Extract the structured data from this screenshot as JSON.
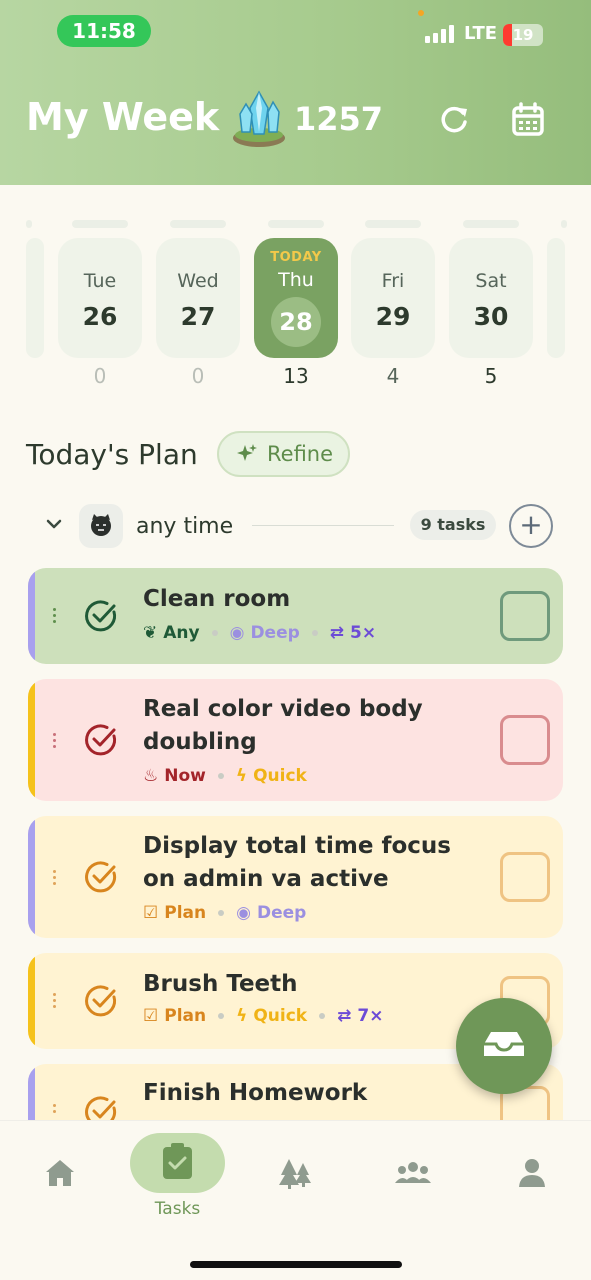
{
  "status_bar": {
    "time": "11:58",
    "network": "LTE",
    "battery": "19"
  },
  "header": {
    "title": "My Week",
    "points": "1257"
  },
  "week": {
    "days": [
      {
        "name": "Tue",
        "date": "26",
        "count": "0"
      },
      {
        "name": "Wed",
        "date": "27",
        "count": "0"
      },
      {
        "name": "Thu",
        "date": "28",
        "count": "13",
        "today_label": "TODAY"
      },
      {
        "name": "Fri",
        "date": "29",
        "count": "4"
      },
      {
        "name": "Sat",
        "date": "30",
        "count": "5"
      }
    ]
  },
  "plan": {
    "title": "Today's Plan",
    "refine_label": "Refine"
  },
  "group": {
    "name": "any time",
    "task_count": "9 tasks",
    "add": "+"
  },
  "tasks": [
    {
      "title": "Clean room",
      "tags": [
        "Any",
        "Deep",
        "5×"
      ]
    },
    {
      "title": "Real color video body doubling",
      "tags": [
        "Now",
        "Quick"
      ]
    },
    {
      "title": "Display total time focus on admin va active",
      "tags": [
        "Plan",
        "Deep"
      ]
    },
    {
      "title": "Brush Teeth",
      "tags": [
        "Plan",
        "Quick",
        "7×"
      ]
    },
    {
      "title": "Finish Homework",
      "tags": []
    }
  ],
  "nav": {
    "tasks_label": "Tasks"
  },
  "colors": {
    "accent": "#7aa262",
    "header": "#a7cb8e",
    "deep": "#9b8fe0",
    "quick": "#f0b316",
    "now": "#a3242a",
    "plan": "#d8851e"
  }
}
